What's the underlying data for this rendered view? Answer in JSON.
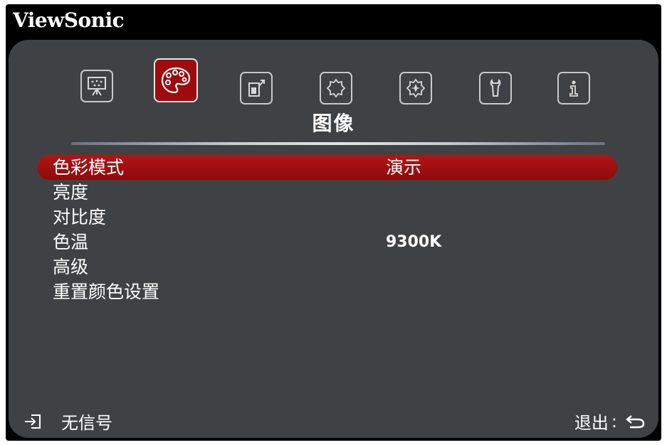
{
  "brand": "ViewSonic",
  "tabs": [
    {
      "name": "display-icon",
      "active": false
    },
    {
      "name": "palette-icon",
      "active": true
    },
    {
      "name": "power-management-icon",
      "active": false
    },
    {
      "name": "basic-settings-icon",
      "active": false
    },
    {
      "name": "advanced-settings-icon",
      "active": false
    },
    {
      "name": "wrench-icon",
      "active": false
    },
    {
      "name": "info-icon",
      "active": false
    }
  ],
  "tab_title": "图像",
  "menu": {
    "items": [
      {
        "label": "色彩模式",
        "value": "演示",
        "selected": true
      },
      {
        "label": "亮度",
        "value": "",
        "selected": false
      },
      {
        "label": "对比度",
        "value": "",
        "selected": false
      },
      {
        "label": "色温",
        "value": "9300K",
        "selected": false
      },
      {
        "label": "高级",
        "value": "",
        "selected": false
      },
      {
        "label": "重置颜色设置",
        "value": "",
        "selected": false
      }
    ]
  },
  "footer": {
    "source_icon": "input-source-icon",
    "source_status": "无信号",
    "exit_label": "退出",
    "exit_separator": ":",
    "exit_icon": "return-arrow-icon"
  },
  "colors": {
    "brand_bar": "#000000",
    "panel": "#3f4244",
    "accent": "#9d0b0d",
    "text": "#ffffff"
  }
}
